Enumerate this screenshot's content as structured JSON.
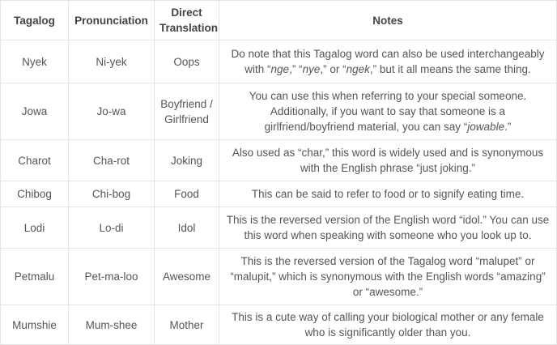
{
  "table": {
    "headers": [
      "Tagalog",
      "Pronunciation",
      "Direct\nTranslation",
      "Notes"
    ],
    "rows": [
      {
        "tagalog": "Nyek",
        "pronunciation": "Ni-yek",
        "translation": "Oops",
        "notes": [
          {
            "t": "Do note that this Tagalog word can also be used interchangeably with “"
          },
          {
            "t": "nge",
            "i": true
          },
          {
            "t": ",” “"
          },
          {
            "t": "nye",
            "i": true
          },
          {
            "t": ",” or “"
          },
          {
            "t": "ngek",
            "i": true
          },
          {
            "t": ",” but it all means the same thing."
          }
        ]
      },
      {
        "tagalog": "Jowa",
        "pronunciation": "Jo-wa",
        "translation": "Boyfriend / Girlfriend",
        "notes": [
          {
            "t": "You can use this when referring to your special someone. Additionally, if you want to say that someone is a girlfriend/boyfriend material, you can say “"
          },
          {
            "t": "jowable",
            "i": true
          },
          {
            "t": ".”"
          }
        ]
      },
      {
        "tagalog": "Charot",
        "pronunciation": "Cha-rot",
        "translation": "Joking",
        "notes": [
          {
            "t": "Also used as “char,” this word is widely used and is synonymous with the English phrase “just joking.”"
          }
        ]
      },
      {
        "tagalog": "Chibog",
        "pronunciation": "Chi-bog",
        "translation": "Food",
        "notes": [
          {
            "t": "This can be said to refer to food or to signify eating time."
          }
        ]
      },
      {
        "tagalog": "Lodi",
        "pronunciation": "Lo-di",
        "translation": "Idol",
        "notes": [
          {
            "t": "This is the reversed version of the English word “idol.” You can use this word when speaking with someone who you look up to."
          }
        ]
      },
      {
        "tagalog": "Petmalu",
        "pronunciation": "Pet-ma-loo",
        "translation": "Awesome",
        "notes": [
          {
            "t": "This is the reversed version of the Tagalog word “malupet” or “malupit,” which is synonymous with the English words “amazing” or “awesome.”"
          }
        ]
      },
      {
        "tagalog": "Mumshie",
        "pronunciation": "Mum-shee",
        "translation": "Mother",
        "notes": [
          {
            "t": "This is a cute way of calling your biological mother or any female who is significantly older than you."
          }
        ]
      }
    ]
  }
}
